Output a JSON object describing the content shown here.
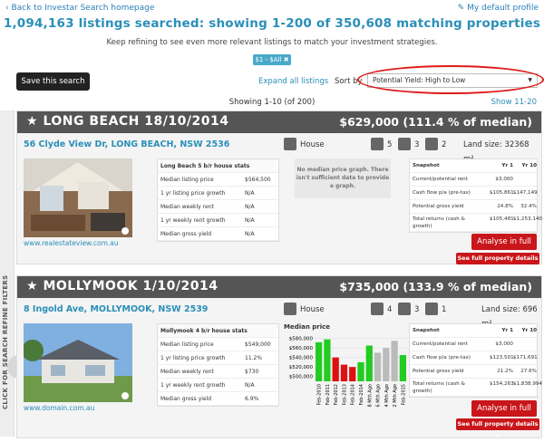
{
  "top": {
    "back_link": "‹ Back to Investar Search homepage",
    "profile_link": "My default profile"
  },
  "headline": "1,094,163 listings searched: showing 1-200 of 350,608 matching properties",
  "subline": "Keep refining to see even more relevant listings to match your investment strategies.",
  "filter_tag": "$1 - $All",
  "save_button": "Save this search",
  "expand_link": "Expand all listings",
  "sort": {
    "label": "Sort by",
    "selected": "Potential Yield: High to Low"
  },
  "showing": "Showing 1-10 (of 200)",
  "show_next": "Show 11-20",
  "side_tab": "CLICK FOR SEARCH REFINE FILTERS",
  "colors": {
    "accent": "#2a8fb8",
    "header": "#555555",
    "action": "#c8161b",
    "highlight": "#e01b1b"
  },
  "listings": [
    {
      "title": "LONG BEACH 18/10/2014",
      "price": "$629,000 (111.4 % of median)",
      "address": "56 Clyde View Dr, LONG BEACH, NSW 2536",
      "type": "House",
      "beds": "5",
      "baths": "3",
      "cars": "2",
      "land": "Land size: 32368 m²",
      "photo_source": "www.realestateview.com.au",
      "stats_title": "Long Beach 5 b/r house stats",
      "stats": [
        {
          "label": "Median listing price",
          "value": "$564,500"
        },
        {
          "label": "1 yr listing price growth",
          "value": "N/A"
        },
        {
          "label": "Median weekly rent",
          "value": "N/A"
        },
        {
          "label": "1 yr weekly rent growth",
          "value": "N/A"
        },
        {
          "label": "Median gross yield",
          "value": "N/A"
        }
      ],
      "no_graph": "No median price graph. There isn't sufficient data to provide a graph.",
      "snapshot": {
        "title": "Snapshot",
        "col1": "Yr 1",
        "col2": "Yr 10",
        "rows": [
          {
            "label": "Current/potential rent",
            "y1": "$3,000",
            "y10": ""
          },
          {
            "label": "Cash flow p/a (pre-tax)",
            "y1": "$105,861",
            "y10": "$147,149"
          },
          {
            "label": "Potential gross yield",
            "y1": "24.8%",
            "y10": "32.4%"
          },
          {
            "label": "Total returns (cash & growth)",
            "y1": "$105,481",
            "y10": "$1,253,140"
          }
        ]
      },
      "analyse": "Analyse in full",
      "details": "See full property details ▾"
    },
    {
      "title": "MOLLYMOOK 1/10/2014",
      "price": "$735,000 (133.9 % of median)",
      "address": "8 Ingold Ave, MOLLYMOOK, NSW 2539",
      "type": "House",
      "beds": "4",
      "baths": "3",
      "cars": "1",
      "land": "Land size: 696 m²",
      "photo_source": "www.domain.com.au",
      "stats_title": "Mollymook 4 b/r house stats",
      "stats": [
        {
          "label": "Median listing price",
          "value": "$549,000"
        },
        {
          "label": "1 yr listing price growth",
          "value": "11.2%"
        },
        {
          "label": "Median weekly rent",
          "value": "$730"
        },
        {
          "label": "1 yr weekly rent growth",
          "value": "N/A"
        },
        {
          "label": "Median gross yield",
          "value": "6.9%"
        }
      ],
      "chart": {
        "title": "Median price",
        "ticks": [
          "$580,000",
          "$560,000",
          "$540,000",
          "$520,000",
          "$500,000"
        ],
        "ylim": [
          490000,
          585000
        ],
        "categories": [
          "Feb-2010",
          "Feb-2011",
          "Feb-2012",
          "Feb-2013",
          "Feb-2014",
          "Feb-2014",
          "8 Mth Ago",
          "6 Mth Ago",
          "4 Mth Ago",
          "2 Mth Ago",
          "Feb-2015"
        ],
        "values": [
          572000,
          578000,
          540000,
          525000,
          520000,
          530000,
          565000,
          550000,
          560000,
          575000,
          545000
        ],
        "colors": [
          "#22cc22",
          "#22cc22",
          "#dd1111",
          "#dd1111",
          "#dd1111",
          "#22cc22",
          "#22cc22",
          "#bbbbbb",
          "#bbbbbb",
          "#bbbbbb",
          "#22cc22"
        ]
      },
      "snapshot": {
        "title": "Snapshot",
        "col1": "Yr 1",
        "col2": "Yr 10",
        "rows": [
          {
            "label": "Current/potential rent",
            "y1": "$3,000",
            "y10": ""
          },
          {
            "label": "Cash flow p/a (pre-tax)",
            "y1": "$123,501",
            "y10": "$171,691"
          },
          {
            "label": "Potential gross yield",
            "y1": "21.2%",
            "y10": "27.6%"
          },
          {
            "label": "Total returns (cash & growth)",
            "y1": "$154,263",
            "y10": "$1,838,994"
          }
        ]
      },
      "analyse": "Analyse in full",
      "details": "See full property details ▾"
    }
  ]
}
